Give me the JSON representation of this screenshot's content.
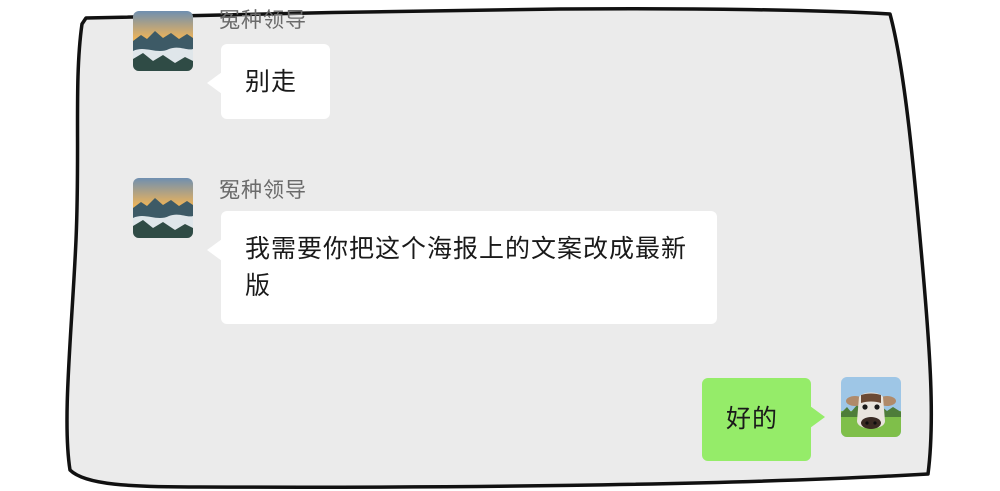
{
  "colors": {
    "chat_background": "#ebebeb",
    "incoming_bubble": "#ffffff",
    "outgoing_bubble": "#95ec69",
    "frame_outline": "#111111",
    "sender_name": "#6a6a6a"
  },
  "messages": [
    {
      "direction": "incoming",
      "sender": "冤种领导",
      "avatar": "mountain-landscape-avatar",
      "text": "别走"
    },
    {
      "direction": "incoming",
      "sender": "冤种领导",
      "avatar": "mountain-landscape-avatar",
      "text": "我需要你把这个海报上的文案改成最新版"
    },
    {
      "direction": "outgoing",
      "avatar": "cow-avatar",
      "text": "好的"
    }
  ]
}
